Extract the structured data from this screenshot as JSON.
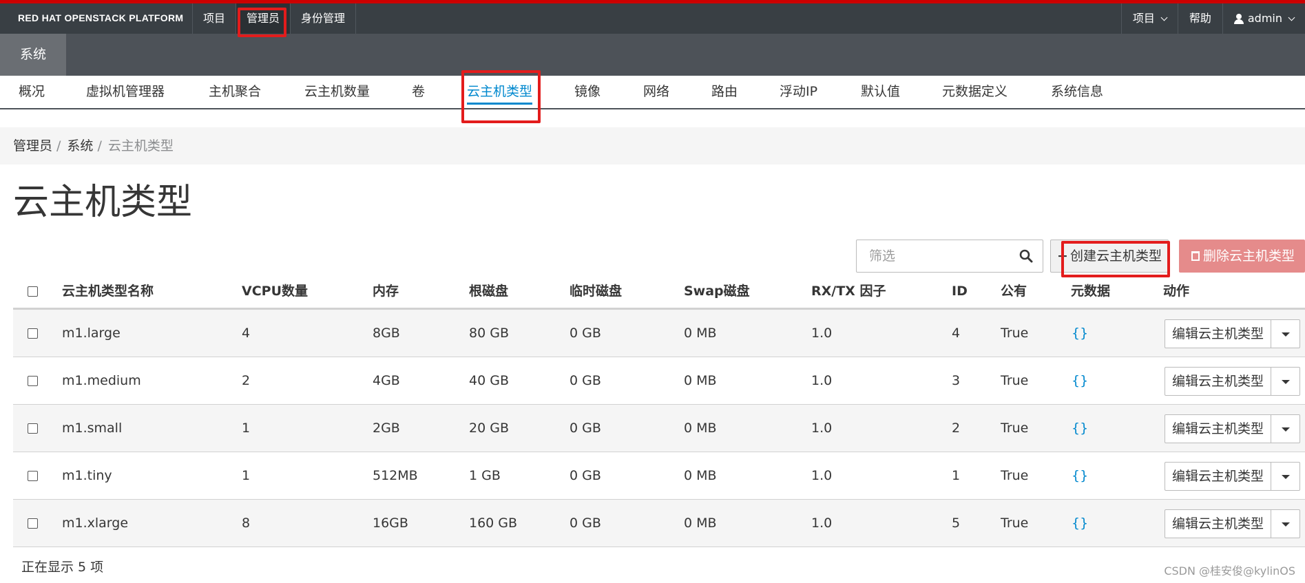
{
  "brand": "RED HAT OPENSTACK PLATFORM",
  "top_nav": [
    "项目",
    "管理员",
    "身份管理"
  ],
  "top_right": {
    "project": "项目",
    "help": "帮助",
    "user": "admin"
  },
  "section": "系统",
  "tabs": [
    "概况",
    "虚拟机管理器",
    "主机聚合",
    "云主机数量",
    "卷",
    "云主机类型",
    "镜像",
    "网络",
    "路由",
    "浮动IP",
    "默认值",
    "元数据定义",
    "系统信息"
  ],
  "active_tab": "云主机类型",
  "breadcrumb": [
    "管理员",
    "系统",
    "云主机类型"
  ],
  "page_title": "云主机类型",
  "toolbar": {
    "filter_placeholder": "筛选",
    "create_label": "创建云主机类型",
    "delete_label": "删除云主机类型"
  },
  "table": {
    "headers": [
      "云主机类型名称",
      "VCPU数量",
      "内存",
      "根磁盘",
      "临时磁盘",
      "Swap磁盘",
      "RX/TX 因子",
      "ID",
      "公有",
      "元数据",
      "动作"
    ],
    "rows": [
      [
        "m1.large",
        "4",
        "8GB",
        "80 GB",
        "0 GB",
        "0 MB",
        "1.0",
        "4",
        "True",
        "{}"
      ],
      [
        "m1.medium",
        "2",
        "4GB",
        "40 GB",
        "0 GB",
        "0 MB",
        "1.0",
        "3",
        "True",
        "{}"
      ],
      [
        "m1.small",
        "1",
        "2GB",
        "20 GB",
        "0 GB",
        "0 MB",
        "1.0",
        "2",
        "True",
        "{}"
      ],
      [
        "m1.tiny",
        "1",
        "512MB",
        "1 GB",
        "0 GB",
        "0 MB",
        "1.0",
        "1",
        "True",
        "{}"
      ],
      [
        "m1.xlarge",
        "8",
        "16GB",
        "160 GB",
        "0 GB",
        "0 MB",
        "1.0",
        "5",
        "True",
        "{}"
      ]
    ],
    "row_action": "编辑云主机类型"
  },
  "footer": "正在显示 5 项",
  "watermark": "CSDN @桂安俊@kylinOS",
  "colors": {
    "topbar": "#393f44",
    "accent_red": "#cc0000",
    "link_blue": "#0088ce",
    "delete_button": "#e58b8b",
    "highlight_box": "#e31c1c"
  }
}
